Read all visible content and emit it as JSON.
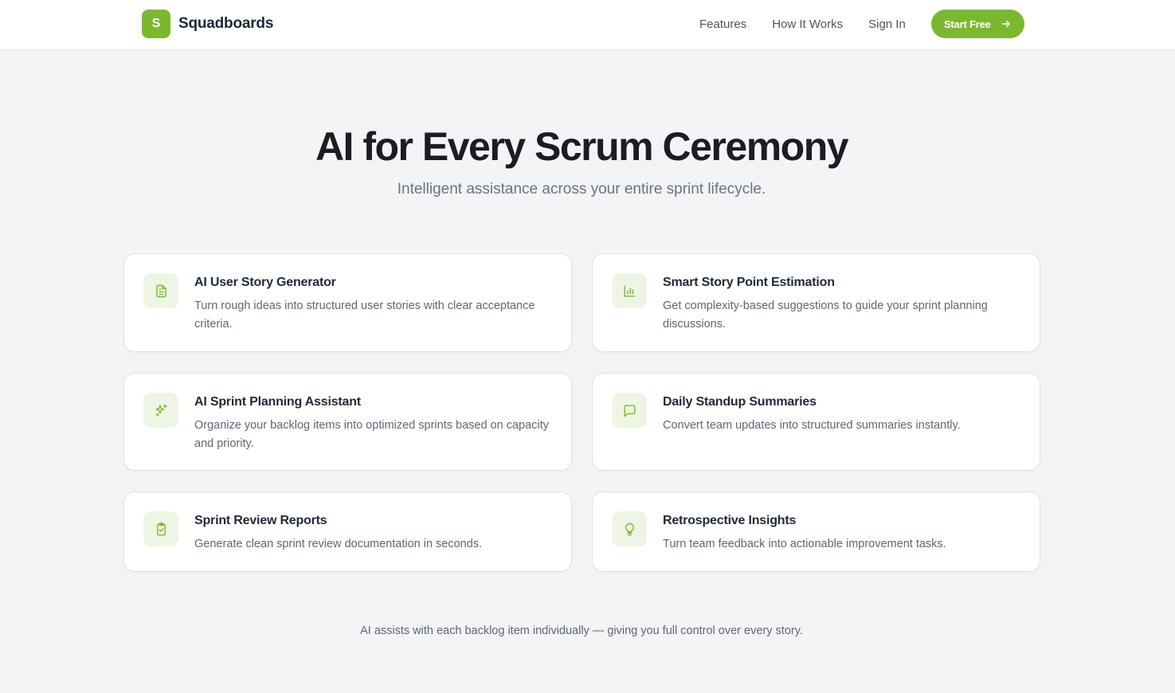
{
  "brand": {
    "logo_letter": "S",
    "name": "Squadboards",
    "accent": "#7cb82f"
  },
  "nav": {
    "links": [
      "Features",
      "How It Works",
      "Sign In"
    ],
    "cta_label": "Start Free",
    "cta_icon": "arrow-right-icon"
  },
  "hero": {
    "title": "AI for Every Scrum Ceremony",
    "subtitle": "Intelligent assistance across your entire sprint lifecycle."
  },
  "features": [
    {
      "icon": "document-icon",
      "title": "AI User Story Generator",
      "description": "Turn rough ideas into structured user stories with clear acceptance criteria."
    },
    {
      "icon": "bar-chart-icon",
      "title": "Smart Story Point Estimation",
      "description": "Get complexity-based suggestions to guide your sprint planning discussions."
    },
    {
      "icon": "sparkles-icon",
      "title": "AI Sprint Planning Assistant",
      "description": "Organize your backlog items into optimized sprints based on capacity and priority."
    },
    {
      "icon": "message-square-icon",
      "title": "Daily Standup Summaries",
      "description": "Convert team updates into structured summaries instantly."
    },
    {
      "icon": "clipboard-check-icon",
      "title": "Sprint Review Reports",
      "description": "Generate clean sprint review documentation in seconds."
    },
    {
      "icon": "lightbulb-icon",
      "title": "Retrospective Insights",
      "description": "Turn team feedback into actionable improvement tasks."
    }
  ],
  "footnote": "AI assists with each backlog item individually — giving you full control over every story.",
  "colors": {
    "accent": "#7cb82f",
    "icon_bg": "#eef5e4",
    "page_bg": "#f3f4f6"
  }
}
